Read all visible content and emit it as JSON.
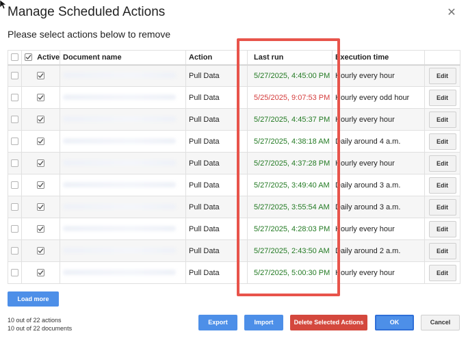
{
  "dialog": {
    "title": "Manage Scheduled Actions",
    "subtitle": "Please select actions below to remove",
    "close_glyph": "✕"
  },
  "table": {
    "columns": [
      "",
      "Active",
      "Document name",
      "Action",
      "Last run",
      "Execution time",
      ""
    ],
    "rows": [
      {
        "active": true,
        "action": "Pull Data",
        "last_run": "5/27/2025, 4:45:00 PM",
        "status": "ok",
        "execution": "Hourly every hour",
        "edit": "Edit"
      },
      {
        "active": true,
        "action": "Pull Data",
        "last_run": "5/25/2025, 9:07:53 PM",
        "status": "error",
        "execution": "Hourly every odd hour",
        "edit": "Edit"
      },
      {
        "active": true,
        "action": "Pull Data",
        "last_run": "5/27/2025, 4:45:37 PM",
        "status": "ok",
        "execution": "Hourly every hour",
        "edit": "Edit"
      },
      {
        "active": true,
        "action": "Pull Data",
        "last_run": "5/27/2025, 4:38:18 AM",
        "status": "ok",
        "execution": "Daily around 4 a.m.",
        "edit": "Edit"
      },
      {
        "active": true,
        "action": "Pull Data",
        "last_run": "5/27/2025, 4:37:28 PM",
        "status": "ok",
        "execution": "Hourly every hour",
        "edit": "Edit"
      },
      {
        "active": true,
        "action": "Pull Data",
        "last_run": "5/27/2025, 3:49:40 AM",
        "status": "ok",
        "execution": "Daily around 3 a.m.",
        "edit": "Edit"
      },
      {
        "active": true,
        "action": "Pull Data",
        "last_run": "5/27/2025, 3:55:54 AM",
        "status": "ok",
        "execution": "Daily around 3 a.m.",
        "edit": "Edit"
      },
      {
        "active": true,
        "action": "Pull Data",
        "last_run": "5/27/2025, 4:28:03 PM",
        "status": "ok",
        "execution": "Hourly every hour",
        "edit": "Edit"
      },
      {
        "active": true,
        "action": "Pull Data",
        "last_run": "5/27/2025, 2:43:50 AM",
        "status": "ok",
        "execution": "Daily around 2 a.m.",
        "edit": "Edit"
      },
      {
        "active": true,
        "action": "Pull Data",
        "last_run": "5/27/2025, 5:00:30 PM",
        "status": "ok",
        "execution": "Hourly every hour",
        "edit": "Edit"
      }
    ]
  },
  "footer": {
    "load_more": "Load more",
    "actions_count": "10 out of 22 actions",
    "documents_count": "10 out of 22 documents",
    "export": "Export",
    "import": "Import",
    "delete_selected": "Delete Selected Actions",
    "ok": "OK",
    "cancel": "Cancel"
  },
  "colors": {
    "status_ok": "#237a23",
    "status_error": "#d43b3b",
    "primary": "#4d8fe8",
    "danger": "#d4483d",
    "highlight": "#e8544b"
  }
}
